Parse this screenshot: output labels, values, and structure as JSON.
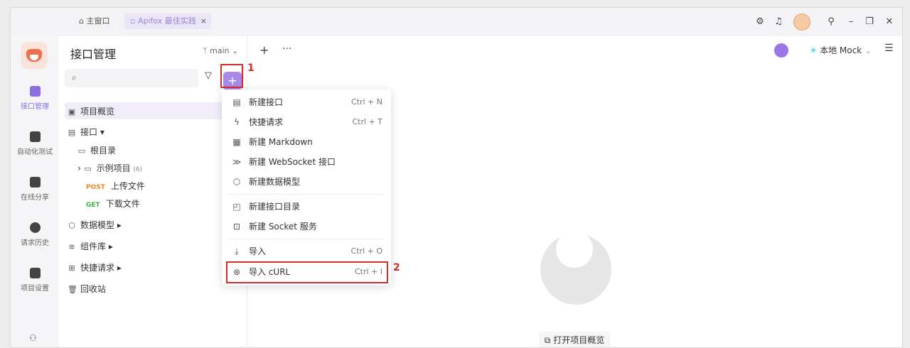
{
  "titlebar": {
    "home_tab": "主窗口",
    "active_tab": "Apifox 最佳实践",
    "close_glyph": "×",
    "icons": [
      "settings-icon",
      "bell-icon",
      "avatar",
      "pin-icon",
      "minimize-icon",
      "restore-icon",
      "close-icon"
    ]
  },
  "rail": {
    "items": [
      {
        "label": "接口管理",
        "icon": "api-icon",
        "active": true
      },
      {
        "label": "自动化测试",
        "icon": "automation-icon"
      },
      {
        "label": "在线分享",
        "icon": "share-icon"
      },
      {
        "label": "请求历史",
        "icon": "history-icon"
      },
      {
        "label": "项目设置",
        "icon": "project-settings-icon"
      }
    ]
  },
  "panel": {
    "title": "接口管理",
    "branch": "main",
    "tree": {
      "overview": "项目概览",
      "interfaces": "接口",
      "root": "根目录",
      "example": "示例项目",
      "example_count": "(6)",
      "upload": {
        "method": "POST",
        "name": "上传文件"
      },
      "download": {
        "method": "GET",
        "name": "下载文件"
      },
      "models": "数据模型",
      "components": "组件库",
      "quick": "快捷请求",
      "trash": "回收站"
    }
  },
  "toolbar": {
    "plus": "+",
    "more": "···",
    "mock_label": "本地 Mock"
  },
  "menu": {
    "items": [
      {
        "label": "新建接口",
        "shortcut": "Ctrl + N",
        "icon": "api-icon"
      },
      {
        "label": "快捷请求",
        "shortcut": "Ctrl + T",
        "icon": "lightning-icon"
      },
      {
        "label": "新建 Markdown",
        "shortcut": "",
        "icon": "markdown-icon"
      },
      {
        "label": "新建 WebSocket 接口",
        "shortcut": "",
        "icon": "websocket-icon"
      },
      {
        "label": "新建数据模型",
        "shortcut": "",
        "icon": "cube-icon"
      },
      {
        "label": "新建接口目录",
        "shortcut": "",
        "icon": "folder-add-icon"
      },
      {
        "label": "新建 Socket 服务",
        "shortcut": "",
        "icon": "socket-icon"
      },
      {
        "label": "导入",
        "shortcut": "Ctrl + O",
        "icon": "import-icon"
      },
      {
        "label": "导入 cURL",
        "shortcut": "Ctrl + I",
        "icon": "curl-icon"
      }
    ]
  },
  "empty": {
    "open_overview": "打开项目概览"
  },
  "annotations": {
    "one": "1",
    "two": "2"
  },
  "colors": {
    "accent": "#a88ae8",
    "annotation": "#d62b2b",
    "post": "#f08a24",
    "get": "#3fb34f"
  }
}
